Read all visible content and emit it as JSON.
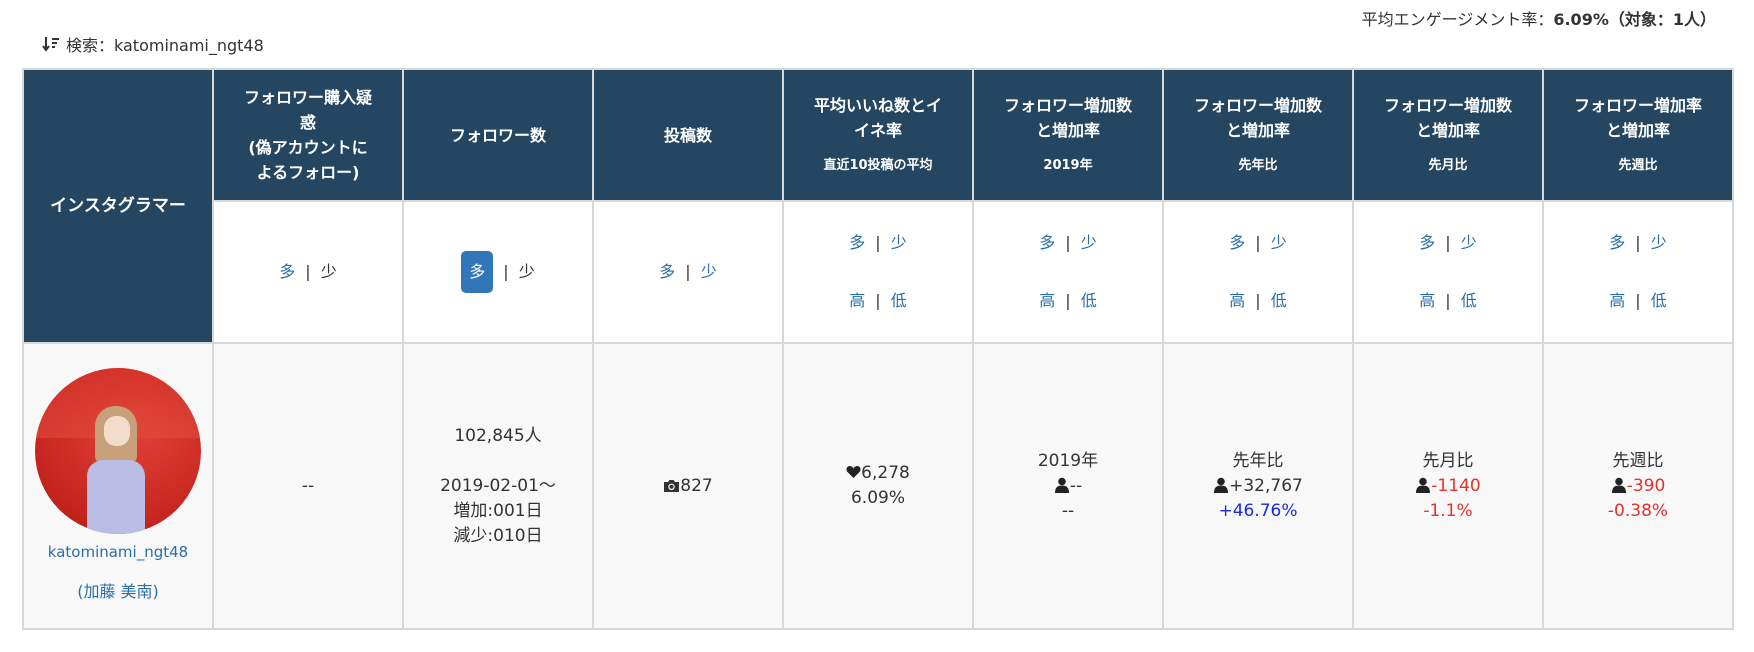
{
  "summary": {
    "label": "平均エンゲージメント率：",
    "rate": "6.09%",
    "target": "（対象：1人）"
  },
  "search": {
    "label": "検索：katominami_ngt48"
  },
  "columns": [
    {
      "title": "インスタグラマー",
      "sub": ""
    },
    {
      "title": "フォロワー購入疑惑\n(偽アカウントによるフォロー)",
      "sub": ""
    },
    {
      "title": "フォロワー数",
      "sub": ""
    },
    {
      "title": "投稿数",
      "sub": ""
    },
    {
      "title": "平均いいね数とイイネ率",
      "sub": "直近10投稿の平均"
    },
    {
      "title": "フォロワー増加数と増加率",
      "sub": "2019年"
    },
    {
      "title": "フォロワー増加数と増加率",
      "sub": "先年比"
    },
    {
      "title": "フォロワー増加数と増加率",
      "sub": "先月比"
    },
    {
      "title": "フォロワー増加率と増加率",
      "sub": "先週比"
    }
  ],
  "sort": {
    "many": "多",
    "few": "少",
    "high": "高",
    "low": "低",
    "sep": "|"
  },
  "row": {
    "username": "katominami_ngt48",
    "name": "(加藤 美南)",
    "fake_followers": "--",
    "followers": "102,845人",
    "since": "2019-02-01～",
    "increase_days": "増加:001日",
    "decrease_days": "減少:010日",
    "posts": "827",
    "likes": "6,278",
    "like_rate": "6.09%",
    "y2019_label": "2019年",
    "y2019_count": "--",
    "y2019_rate": "--",
    "yoy_label": "先年比",
    "yoy_count": "+32,767",
    "yoy_rate": "+46.76%",
    "mom_label": "先月比",
    "mom_count": "-1140",
    "mom_rate": "-1.1%",
    "wow_label": "先週比",
    "wow_count": "-390",
    "wow_rate": "-0.38%"
  },
  "colors": {
    "header_bg": "#244660",
    "link": "#2a6ea8",
    "active_pill": "#3176b8",
    "positive": "#1a2ae0",
    "negative": "#e1332b"
  }
}
